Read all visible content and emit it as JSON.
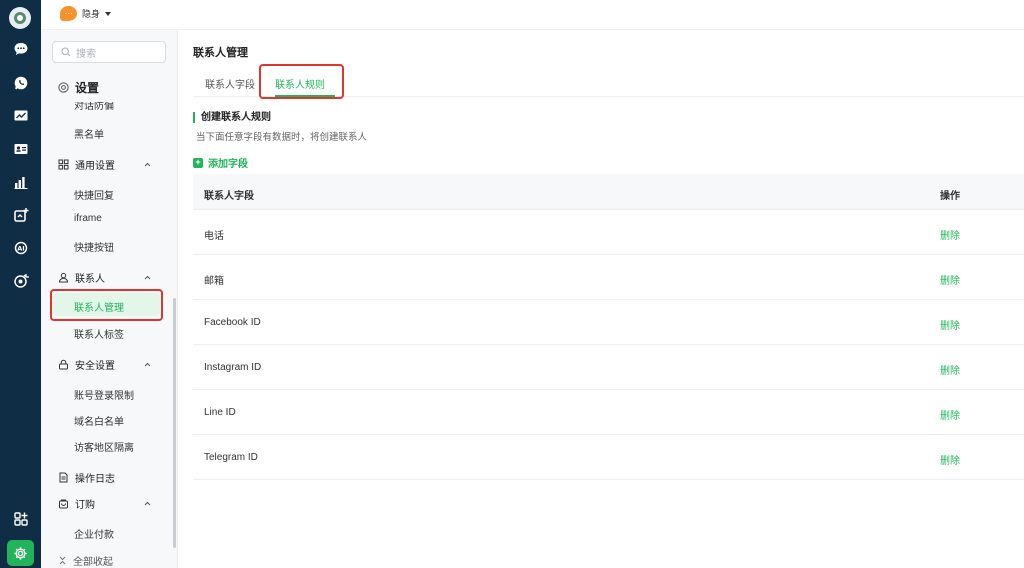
{
  "rail": {
    "icons": [
      "logo-icon",
      "chat-icon",
      "whatsapp-icon",
      "analytics-icon",
      "contact-card-icon",
      "bar-chart-icon",
      "marketing-icon",
      "ai-icon",
      "target-icon",
      "apps-add-icon",
      "settings-icon"
    ],
    "accent": "#22b45a",
    "background": "#0f2d44"
  },
  "topbar": {
    "status_label": "隐身"
  },
  "sidebar": {
    "search_placeholder": "搜索",
    "settings_title": "设置",
    "clipped_item": "对话防偏",
    "blacklist": "黑名单",
    "groups": {
      "general": {
        "label": "通用设置",
        "items": [
          "快捷回复",
          "iframe",
          "快捷按钮"
        ]
      },
      "contacts": {
        "label": "联系人",
        "items": [
          "联系人管理",
          "联系人标签"
        ]
      },
      "security": {
        "label": "安全设置",
        "items": [
          "账号登录限制",
          "域名白名单",
          "访客地区隔离"
        ]
      },
      "oplog": {
        "label": "操作日志"
      },
      "subscription": {
        "label": "订购",
        "items": [
          "企业付款"
        ]
      }
    },
    "collapse_all": "全部收起"
  },
  "main": {
    "page_title": "联系人管理",
    "tabs": [
      "联系人字段",
      "联系人规则"
    ],
    "active_tab": "联系人规则",
    "section_title": "创建联系人规则",
    "section_desc": "当下面任意字段有数据时，将创建联系人",
    "add_field": "添加字段",
    "table": {
      "headers": [
        "联系人字段",
        "操作"
      ],
      "rows": [
        {
          "field": "电话",
          "action": "删除"
        },
        {
          "field": "邮箱",
          "action": "删除"
        },
        {
          "field": "Facebook ID",
          "action": "删除"
        },
        {
          "field": "Instagram ID",
          "action": "删除"
        },
        {
          "field": "Line ID",
          "action": "删除"
        },
        {
          "field": "Telegram ID",
          "action": "删除"
        }
      ]
    }
  }
}
